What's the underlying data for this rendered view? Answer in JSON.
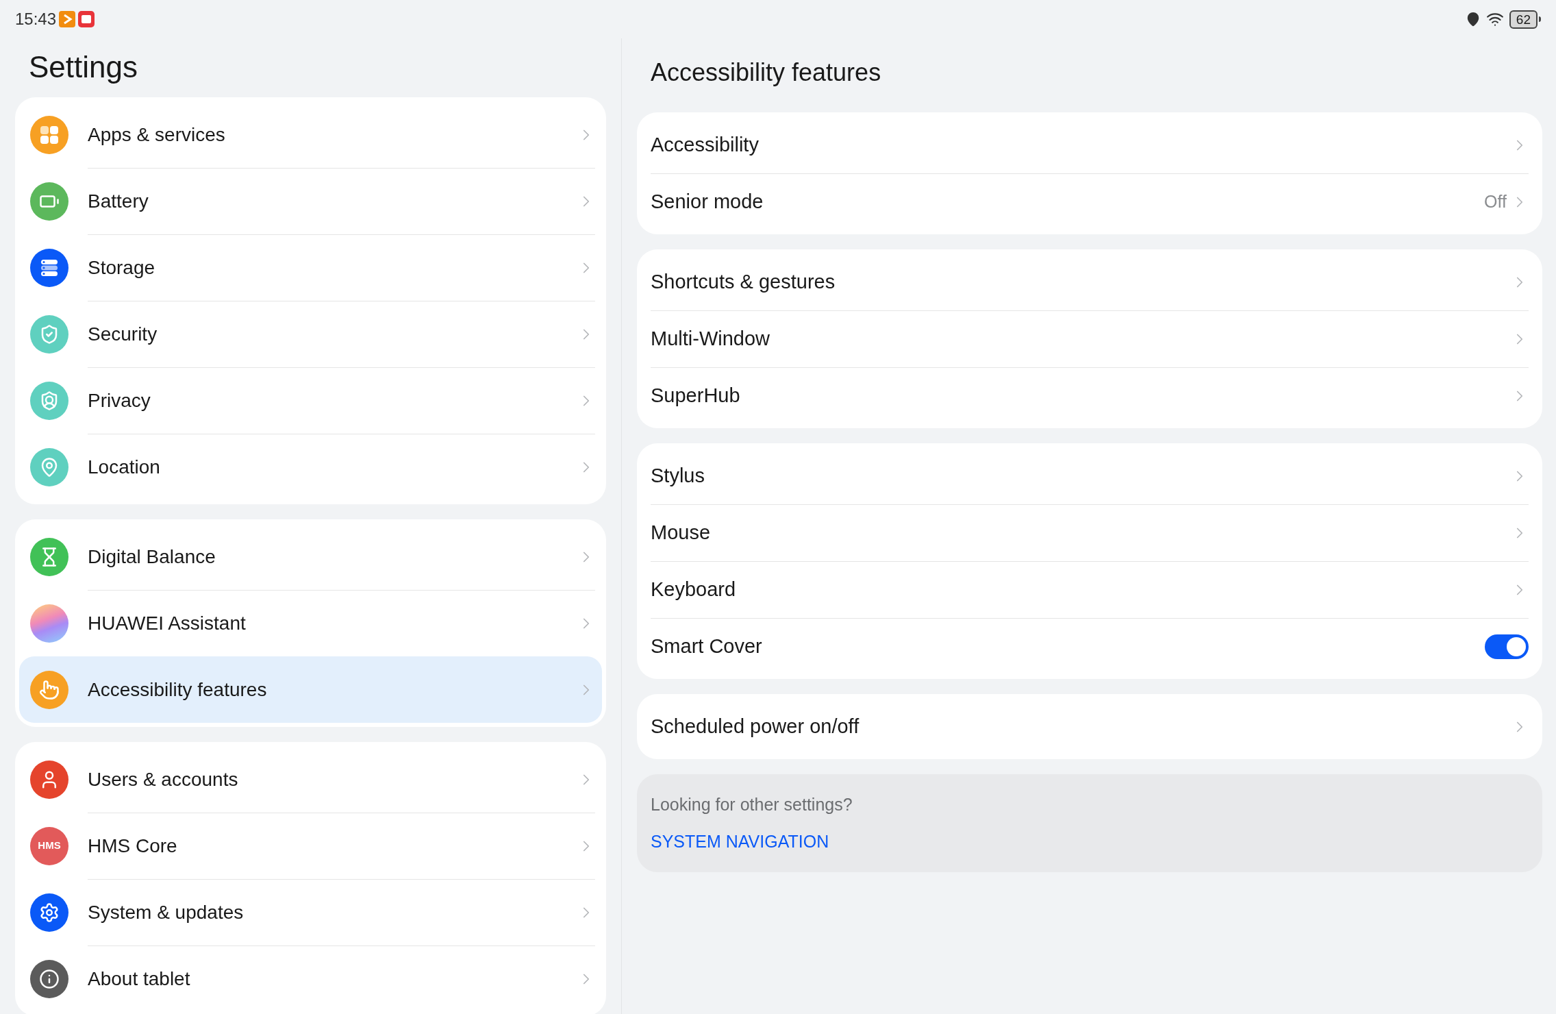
{
  "status_bar": {
    "time": "15:43",
    "battery": "62"
  },
  "sidebar": {
    "title": "Settings",
    "groups": [
      {
        "items": [
          {
            "label": "Apps & services",
            "kind": "apps",
            "color": "#f7a023",
            "selected": false
          },
          {
            "label": "Battery",
            "kind": "battery",
            "color": "#5cb85c",
            "selected": false
          },
          {
            "label": "Storage",
            "kind": "storage",
            "color": "#0a59f7",
            "selected": false
          },
          {
            "label": "Security",
            "kind": "shield",
            "color": "#5fd0bf",
            "selected": false
          },
          {
            "label": "Privacy",
            "kind": "privacy",
            "color": "#5fd0bf",
            "selected": false
          },
          {
            "label": "Location",
            "kind": "pin",
            "color": "#5fd0bf",
            "selected": false
          }
        ]
      },
      {
        "items": [
          {
            "label": "Digital Balance",
            "kind": "hourglass",
            "color": "#41c157",
            "selected": false
          },
          {
            "label": "HUAWEI Assistant",
            "kind": "assistant",
            "selected": false
          },
          {
            "label": "Accessibility features",
            "kind": "hand",
            "color": "#f7a023",
            "selected": true
          }
        ]
      },
      {
        "items": [
          {
            "label": "Users & accounts",
            "kind": "user",
            "color": "#e5442c",
            "selected": false
          },
          {
            "label": "HMS Core",
            "kind": "text",
            "icon_text": "HMS",
            "color": "#e25a5a",
            "selected": false
          },
          {
            "label": "System & updates",
            "kind": "gear",
            "color": "#0a59f7",
            "selected": false
          },
          {
            "label": "About tablet",
            "kind": "info",
            "color": "#5b5b5b",
            "selected": false
          }
        ]
      }
    ]
  },
  "detail": {
    "title": "Accessibility features",
    "groups": [
      {
        "items": [
          {
            "label": "Accessibility",
            "kind": "link"
          },
          {
            "label": "Senior mode",
            "kind": "value",
            "value": "Off"
          }
        ]
      },
      {
        "items": [
          {
            "label": "Shortcuts & gestures",
            "kind": "link"
          },
          {
            "label": "Multi-Window",
            "kind": "link"
          },
          {
            "label": "SuperHub",
            "kind": "link"
          }
        ]
      },
      {
        "items": [
          {
            "label": "Stylus",
            "kind": "link"
          },
          {
            "label": "Mouse",
            "kind": "link"
          },
          {
            "label": "Keyboard",
            "kind": "link"
          },
          {
            "label": "Smart Cover",
            "kind": "toggle",
            "on": true
          }
        ]
      },
      {
        "items": [
          {
            "label": "Scheduled power on/off",
            "kind": "link"
          }
        ]
      }
    ],
    "hint": {
      "text": "Looking for other settings?",
      "link": "SYSTEM NAVIGATION"
    }
  }
}
